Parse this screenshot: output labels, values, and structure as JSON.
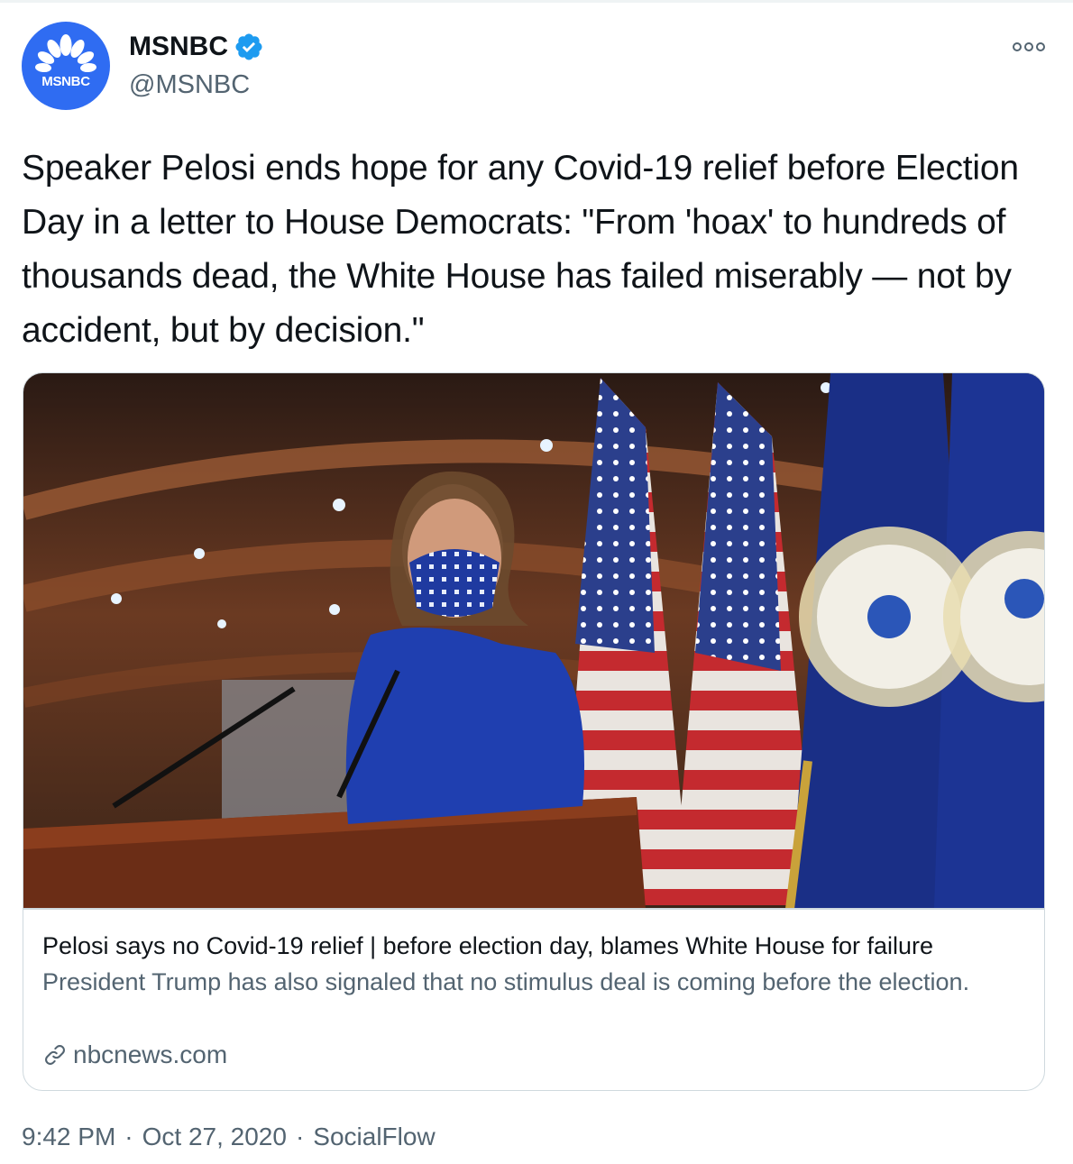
{
  "account": {
    "display_name": "MSNBC",
    "handle": "@MSNBC",
    "avatar_text": "MSNBC",
    "verified": true,
    "avatar_color": "#2f6cf2"
  },
  "tweet": {
    "text": "Speaker Pelosi ends hope for any Covid-19 relief before Election Day in a letter to House Democrats: \"From 'hoax' to hundreds of thousands dead, the White House has failed miserably — not by accident, but by decision.\""
  },
  "card": {
    "title": "Pelosi says no Covid-19 relief | before election day, blames White House for failure",
    "description": "President Trump has also signaled that no stimulus deal is coming before the election.",
    "domain": "nbcnews.com"
  },
  "meta": {
    "time": "9:42 PM",
    "separator": "·",
    "date": "Oct 27, 2020",
    "source": "SocialFlow"
  },
  "icons": {
    "more": "more-horizontal-icon",
    "verified": "verified-badge-icon",
    "link": "link-icon"
  },
  "colors": {
    "text_primary": "#0f1419",
    "text_secondary": "#536471",
    "verified_blue": "#1d9bf0",
    "border": "#cfd9de"
  }
}
